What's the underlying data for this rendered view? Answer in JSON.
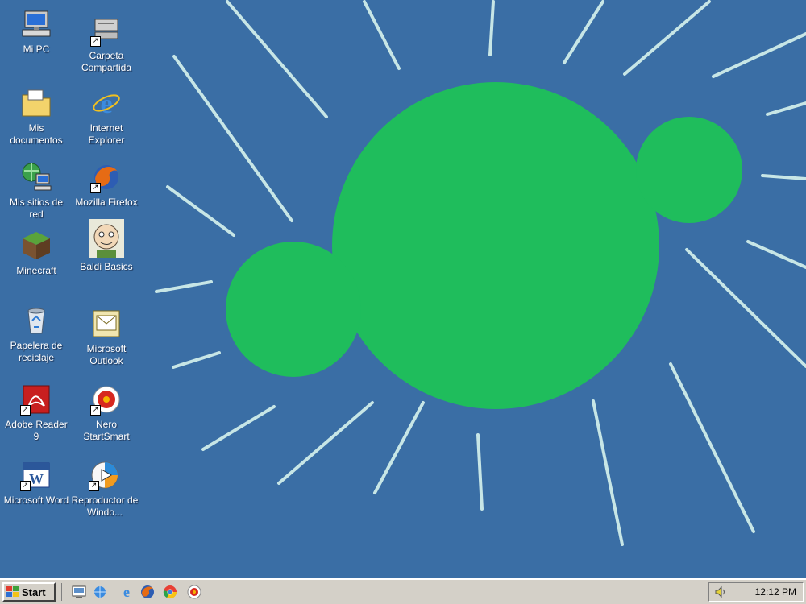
{
  "desktop": {
    "icons": [
      {
        "label": "Mi PC",
        "icon": "computer-icon"
      },
      {
        "label": "Carpeta Compartida",
        "icon": "shared-folder-icon"
      },
      {
        "label": "Mis documentos",
        "icon": "documents-folder-icon"
      },
      {
        "label": "Internet Explorer",
        "icon": "internet-explorer-icon"
      },
      {
        "label": "Mis sitios de red",
        "icon": "network-places-icon"
      },
      {
        "label": "Mozilla Firefox",
        "icon": "firefox-icon"
      },
      {
        "label": "Minecraft",
        "icon": "minecraft-icon"
      },
      {
        "label": "Baldi Basics",
        "icon": "baldi-icon"
      },
      {
        "label": "Papelera de reciclaje",
        "icon": "recycle-bin-icon"
      },
      {
        "label": "Microsoft Outlook",
        "icon": "outlook-icon"
      },
      {
        "label": "Adobe Reader 9",
        "icon": "adobe-reader-icon"
      },
      {
        "label": "Nero StartSmart",
        "icon": "nero-icon"
      },
      {
        "label": "Microsoft Word",
        "icon": "word-icon"
      },
      {
        "label": "Reproductor de Windo...",
        "icon": "media-player-icon"
      }
    ]
  },
  "wallpaper": {
    "background_color": "#3a6ea5",
    "shape_color": "#1fbd5c",
    "ray_color": "#c7e6e6"
  },
  "taskbar": {
    "start_label": "Start",
    "quick_launch": [
      "show-desktop-icon",
      "network-icon",
      "internet-explorer-icon",
      "firefox-icon",
      "chrome-icon",
      "nero-icon"
    ],
    "clock": "12:12 PM",
    "tray_icon": "volume-icon"
  }
}
